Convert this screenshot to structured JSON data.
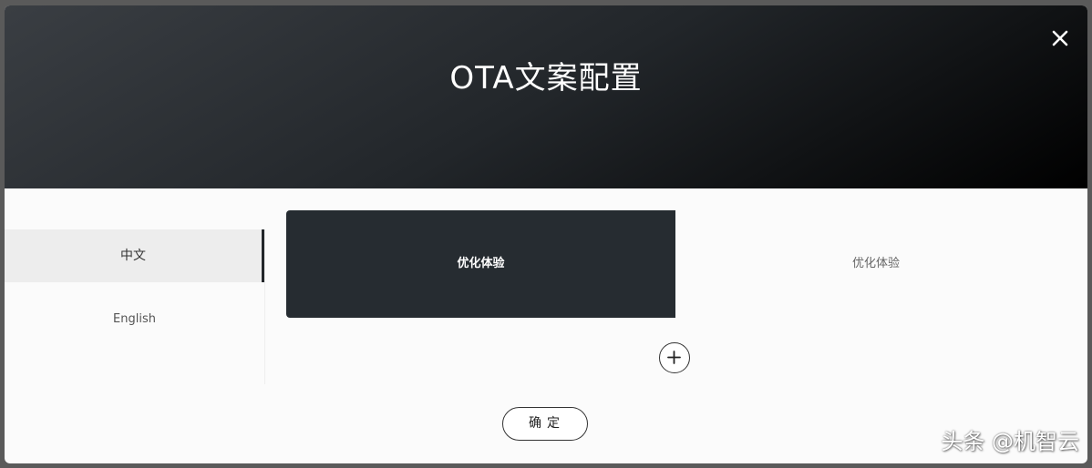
{
  "modal": {
    "title": "OTA文案配置",
    "close_icon": "close-icon"
  },
  "languages": [
    {
      "label": "中文",
      "selected": true
    },
    {
      "label": "English",
      "selected": false
    }
  ],
  "copy_items": [
    {
      "text": "优化体验",
      "selected": true
    },
    {
      "text": "优化体验",
      "selected": false
    }
  ],
  "add_icon": "plus-icon",
  "confirm_label": "确定",
  "watermark": "头条 @机智云",
  "colors": {
    "header_dark": "#22262a",
    "selected_card": "#262c31",
    "active_lang_bg": "#ededed"
  }
}
